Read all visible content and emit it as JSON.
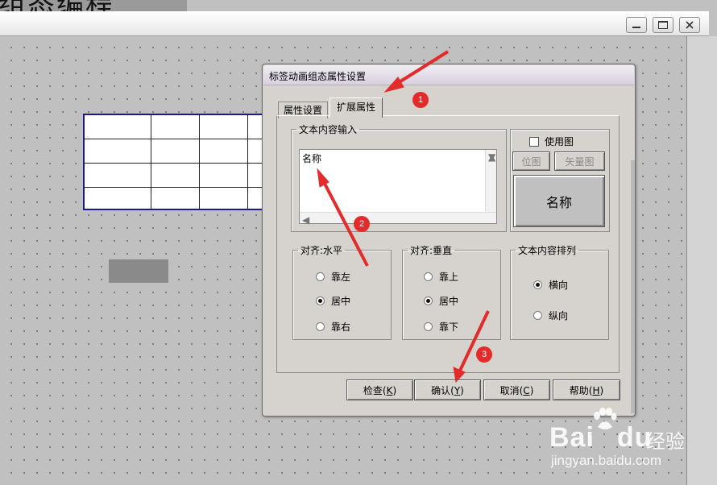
{
  "background_title": "组态编程",
  "canvas_window": {
    "min_icon": "minimize-icon",
    "max_icon": "maximize-icon",
    "close_icon": "close-icon"
  },
  "dialog": {
    "title": "标签动画组态属性设置",
    "tabs": [
      {
        "label": "属性设置",
        "active": false
      },
      {
        "label": "扩展属性",
        "active": true
      }
    ],
    "text_group": {
      "legend": "文本内容输入",
      "value": "名称"
    },
    "image_group": {
      "use_image_label": "使用图",
      "use_image_checked": false,
      "bitmap_button": "位图",
      "vector_button": "矢量图",
      "preview_text": "名称"
    },
    "align_h": {
      "legend": "对齐:水平",
      "options": [
        "靠左",
        "居中",
        "靠右"
      ],
      "selected": "居中"
    },
    "align_v": {
      "legend": "对齐:垂直",
      "options": [
        "靠上",
        "居中",
        "靠下"
      ],
      "selected": "居中"
    },
    "arrange": {
      "legend": "文本内容排列",
      "options": [
        "横向",
        "纵向"
      ],
      "selected": "横向"
    },
    "buttons": {
      "check": {
        "text": "检查(",
        "key": "K",
        "end": ")"
      },
      "ok": {
        "text": "确认(",
        "key": "Y",
        "end": ")"
      },
      "cancel": {
        "text": "取消(",
        "key": "C",
        "end": ")"
      },
      "help": {
        "text": "帮助(",
        "key": "H",
        "end": ")"
      }
    }
  },
  "annotations": [
    "1",
    "2",
    "3"
  ],
  "colors": {
    "annotation": "#e32b2b",
    "table_border": "#1a1a8c"
  },
  "watermark": {
    "brand": "Bai",
    "brand2": "du",
    "suffix": "经验",
    "url": "jingyan.baidu.com"
  }
}
